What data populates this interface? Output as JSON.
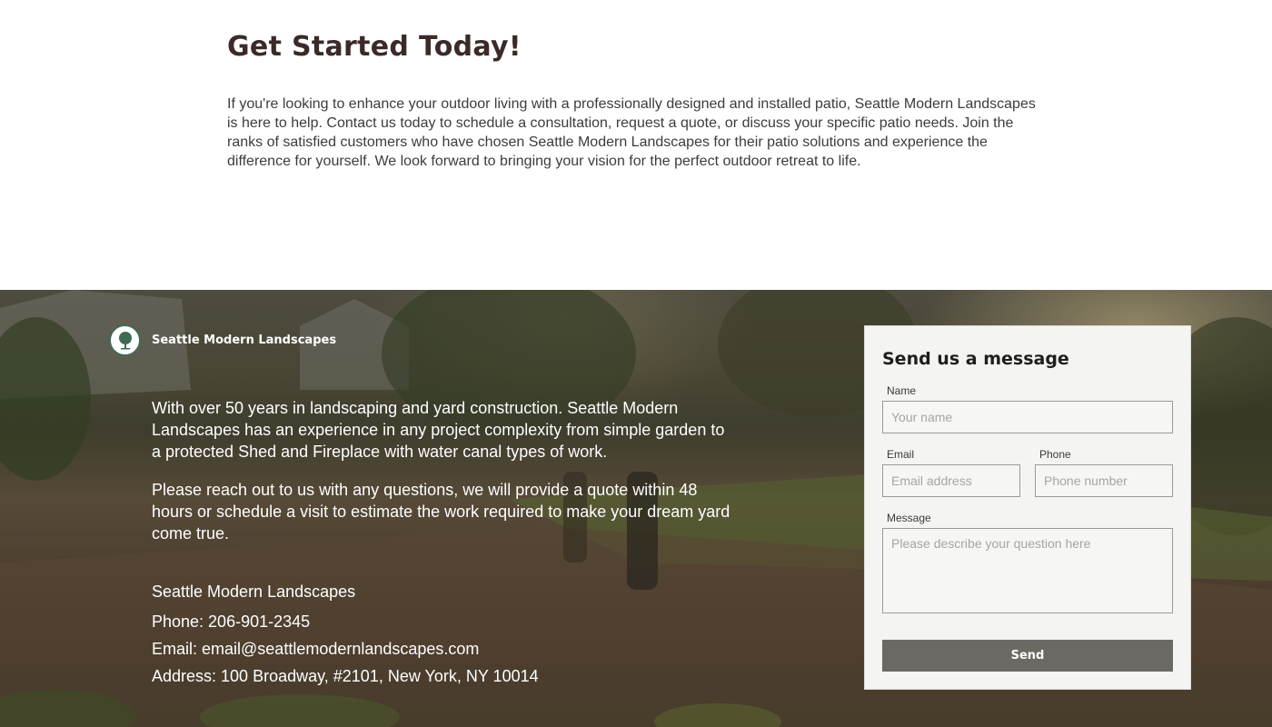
{
  "intro": {
    "title": "Get Started Today!",
    "body": "If you're looking to enhance your outdoor living with a professionally designed and installed patio, Seattle Modern Landscapes is here to help. Contact us today to schedule a consultation, request a quote, or discuss your specific patio needs. Join the ranks of satisfied customers who have chosen Seattle Modern Landscapes for their patio solutions and experience the difference for yourself. We look forward to bringing your vision for the perfect outdoor retreat to life."
  },
  "footer": {
    "brand_name": "Seattle Modern Landscapes",
    "logo_icon": "tree-icon",
    "about": [
      "With over 50 years in landscaping and yard construction. Seattle Modern Landscapes has an experience in any project complexity from simple garden to a protected Shed and Fireplace with water canal types of work.",
      "Please reach out to us with any questions, we will provide a quote within 48 hours or schedule a visit to estimate the work required to make your dream yard come true."
    ],
    "contact": {
      "company": "Seattle Modern Landscapes",
      "phone": "Phone: 206-901-2345",
      "email": "Email: email@seattlemodernlandscapes.com",
      "address": "Address: 100 Broadway, #2101, New York, NY 10014"
    }
  },
  "form": {
    "title": "Send us a message",
    "name_label": "Name",
    "name_placeholder": "Your name",
    "email_label": "Email",
    "email_placeholder": "Email address",
    "phone_label": "Phone",
    "phone_placeholder": "Phone number",
    "message_label": "Message",
    "message_placeholder": "Please describe your question here",
    "send_label": "Send"
  },
  "colors": {
    "heading": "#3b2a28",
    "button": "#6b6963",
    "logo_green": "#3f6b55"
  }
}
